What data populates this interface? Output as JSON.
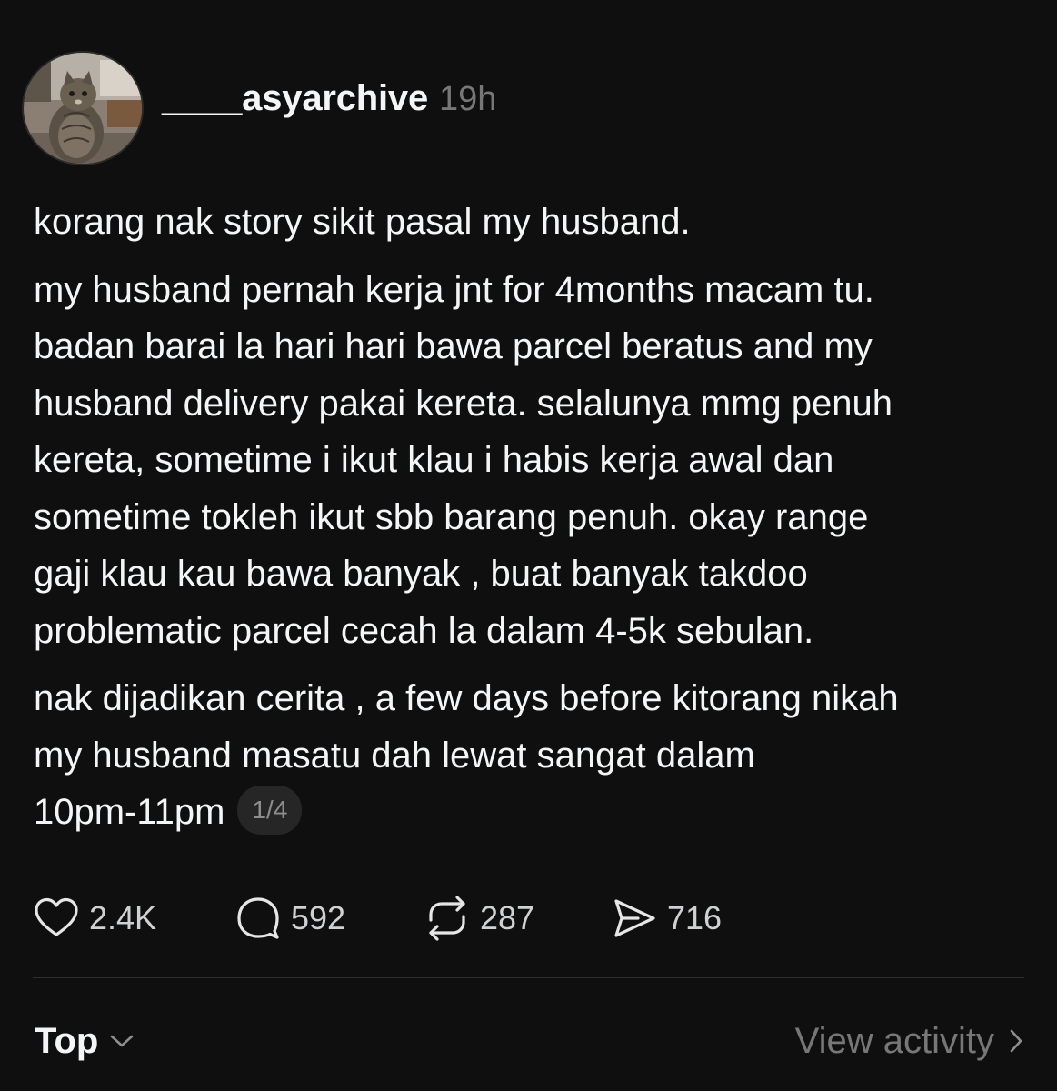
{
  "post": {
    "username": "____asyarchive",
    "timestamp": "19h",
    "paragraphs": [
      "korang nak story sikit pasal my husband.",
      "my husband pernah kerja jnt for 4months macam tu.\nbadan barai la hari hari bawa parcel beratus and my\nhusband delivery pakai kereta. selalunya mmg penuh\nkereta, sometime i ikut klau i habis kerja awal dan\nsometime tokleh ikut sbb barang penuh. okay range\ngaji klau kau bawa banyak , buat banyak takdoo\nproblematic parcel cecah la dalam 4-5k sebulan.",
      "nak dijadikan cerita , a few days before kitorang nikah\nmy husband masatu dah lewat sangat dalam\n10pm-11pm"
    ],
    "page_indicator": "1/4"
  },
  "actions": {
    "likes": "2.4K",
    "replies": "592",
    "reposts": "287",
    "shares": "716"
  },
  "footer": {
    "sort_label": "Top",
    "view_activity_label": "View activity"
  },
  "colors": {
    "background": "#0f0f0f",
    "primary_text": "#f3f5f7",
    "secondary_text": "#777777",
    "badge_bg": "#262626"
  }
}
